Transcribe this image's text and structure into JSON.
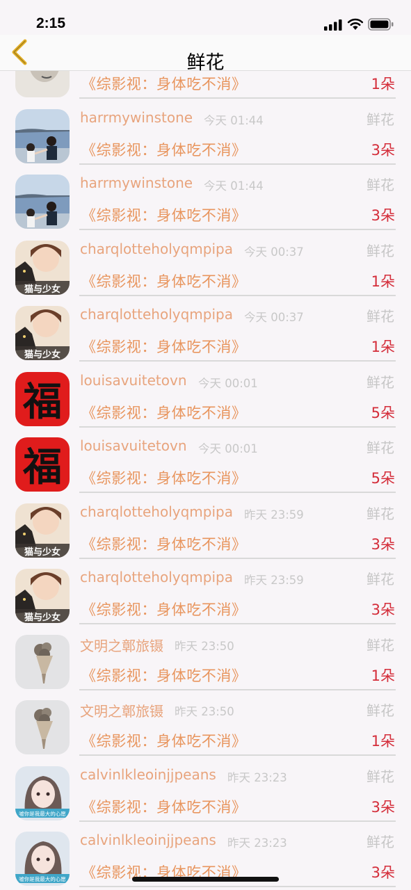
{
  "status": {
    "time": "2:15"
  },
  "nav": {
    "title": "鲜花"
  },
  "rows": [
    {
      "name": "",
      "time": "",
      "gift": "",
      "book": "《综影视：身体吃不消》",
      "count": "1朵",
      "avatar": "sketch-avatar"
    },
    {
      "name": "harrmywinstone",
      "time": "今天 01:44",
      "gift": "鲜花",
      "book": "《综影视：身体吃不消》",
      "count": "3朵",
      "avatar": "beach-couple-avatar"
    },
    {
      "name": "harrmywinstone",
      "time": "今天 01:44",
      "gift": "鲜花",
      "book": "《综影视：身体吃不消》",
      "count": "3朵",
      "avatar": "beach-couple-avatar"
    },
    {
      "name": "charqlotteholyqmpipa",
      "time": "今天 00:37",
      "gift": "鲜花",
      "book": "《综影视：身体吃不消》",
      "count": "1朵",
      "avatar": "girl-cat-avatar",
      "avatar_text": "猫与少女"
    },
    {
      "name": "charqlotteholyqmpipa",
      "time": "今天 00:37",
      "gift": "鲜花",
      "book": "《综影视：身体吃不消》",
      "count": "1朵",
      "avatar": "girl-cat-avatar",
      "avatar_text": "猫与少女"
    },
    {
      "name": "louisavuitetovn",
      "time": "今天 00:01",
      "gift": "鲜花",
      "book": "《综影视：身体吃不消》",
      "count": "5朵",
      "avatar": "fu-character-avatar",
      "avatar_text": "福"
    },
    {
      "name": "louisavuitetovn",
      "time": "今天 00:01",
      "gift": "鲜花",
      "book": "《综影视：身体吃不消》",
      "count": "5朵",
      "avatar": "fu-character-avatar",
      "avatar_text": "福"
    },
    {
      "name": "charqlotteholyqmpipa",
      "time": "昨天 23:59",
      "gift": "鲜花",
      "book": "《综影视：身体吃不消》",
      "count": "3朵",
      "avatar": "girl-cat-avatar",
      "avatar_text": "猫与少女"
    },
    {
      "name": "charqlotteholyqmpipa",
      "time": "昨天 23:59",
      "gift": "鲜花",
      "book": "《综影视：身体吃不消》",
      "count": "3朵",
      "avatar": "girl-cat-avatar",
      "avatar_text": "猫与少女"
    },
    {
      "name": "文明之鄣旅镊",
      "time": "昨天 23:50",
      "gift": "鲜花",
      "book": "《综影视：身体吃不消》",
      "count": "1朵",
      "avatar": "bouquet-avatar"
    },
    {
      "name": "文明之鄣旅镊",
      "time": "昨天 23:50",
      "gift": "鲜花",
      "book": "《综影视：身体吃不消》",
      "count": "1朵",
      "avatar": "bouquet-avatar"
    },
    {
      "name": "calvinlkleoinjjpeans",
      "time": "昨天 23:23",
      "gift": "鲜花",
      "book": "《综影视：身体吃不消》",
      "count": "3朵",
      "avatar": "anime-girl-avatar",
      "avatar_text": "嘘你是我最大的心愿"
    },
    {
      "name": "calvinlkleoinjjpeans",
      "time": "昨天 23:23",
      "gift": "鲜花",
      "book": "《综影视：身体吃不消》",
      "count": "3朵",
      "avatar": "anime-girl-avatar",
      "avatar_text": "嘘你是我最大的心愿"
    }
  ]
}
